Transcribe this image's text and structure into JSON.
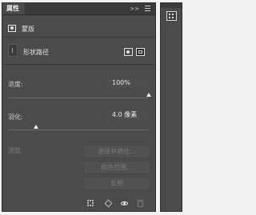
{
  "panel": {
    "tab_title": "属性",
    "collapse_glyph": ">>",
    "section_title": "蒙版",
    "layer_name": "形状路径",
    "density": {
      "label": "浓度:",
      "value": "100%",
      "level": 1.0
    },
    "feather": {
      "label": "羽化:",
      "value": "4.0 像素",
      "level": 0.2
    },
    "refine": {
      "label": "调整:",
      "select_subject_btn": "选择并遮住...",
      "color_range_btn": "颜色范围...",
      "invert_btn": "反相"
    }
  },
  "bottom_icons": [
    "selection-from-mask-icon",
    "apply-mask-icon",
    "visibility-eye-icon",
    "delete-mask-icon"
  ],
  "side_dock": {
    "icon": "properties-panel-icon"
  },
  "colors": {
    "panel_bg": "#4b4b4b",
    "tab_bar": "#3a3a3a",
    "value_field": "#4e4e4e",
    "slider_thumb": "#ececec"
  }
}
